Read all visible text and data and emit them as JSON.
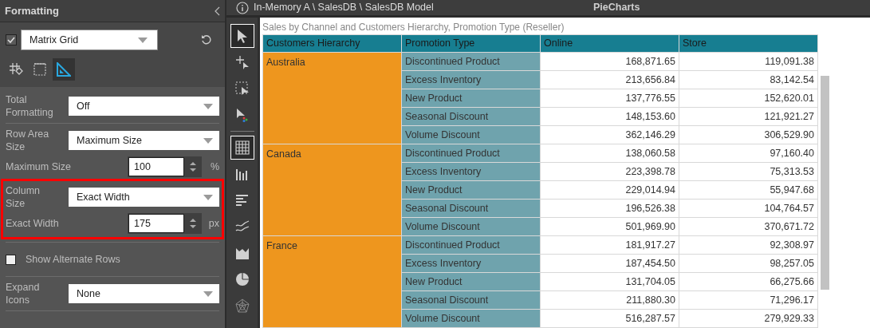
{
  "panel": {
    "title": "Formatting",
    "element": {
      "checked": true,
      "value": "Matrix Grid"
    },
    "tabs": [
      {
        "kind": "tag",
        "selected": false
      },
      {
        "kind": "border",
        "selected": false
      },
      {
        "kind": "ruler",
        "selected": true
      }
    ],
    "sections": [
      {
        "highlighted": false,
        "items": [
          {
            "kind": "select",
            "label": "Total Formatting",
            "value": "Off"
          }
        ]
      },
      {
        "highlighted": false,
        "items": [
          {
            "kind": "select",
            "label": "Row Area Size",
            "value": "Maximum Size"
          },
          {
            "kind": "number",
            "label": "Maximum Size",
            "value": "100",
            "unit": "%"
          }
        ]
      },
      {
        "highlighted": true,
        "items": [
          {
            "kind": "select",
            "label": "Column Size",
            "value": "Exact Width"
          },
          {
            "kind": "number",
            "label": "Exact Width",
            "value": "175",
            "unit": "px"
          }
        ]
      },
      {
        "highlighted": false,
        "items": [
          {
            "kind": "checkbox",
            "label": "Show Alternate Rows",
            "checked": false
          }
        ]
      },
      {
        "highlighted": false,
        "items": [
          {
            "kind": "select",
            "label": "Expand Icons",
            "value": "None"
          }
        ]
      }
    ]
  },
  "breadcrumb": "In-Memory A \\ SalesDB \\ SalesDB Model",
  "report_title": "PieCharts",
  "toolbar": {
    "tools": [
      {
        "kind": "pointer",
        "selected": true
      },
      {
        "kind": "add",
        "selected": false
      },
      {
        "kind": "lasso",
        "selected": false
      },
      {
        "kind": "paint",
        "selected": false
      }
    ],
    "visuals": [
      {
        "kind": "grid",
        "selected": true
      },
      {
        "kind": "columns",
        "selected": false
      },
      {
        "kind": "bars",
        "selected": false
      },
      {
        "kind": "lines",
        "selected": false
      },
      {
        "kind": "area",
        "selected": false
      },
      {
        "kind": "pie",
        "selected": false
      },
      {
        "kind": "radar",
        "selected": false
      }
    ]
  },
  "visual": {
    "title": "Sales by Channel and Customers Hierarchy, Promotion Type (Reseller)",
    "columns": [
      "Customers Hierarchy",
      "Promotion Type",
      "Online",
      "Store"
    ],
    "groups": [
      {
        "label": "Australia",
        "rows": [
          {
            "promotion": "Discontinued Product",
            "online": "168,871.65",
            "store": "119,091.38"
          },
          {
            "promotion": "Excess Inventory",
            "online": "213,656.84",
            "store": "83,142.54"
          },
          {
            "promotion": "New Product",
            "online": "137,776.55",
            "store": "152,620.01"
          },
          {
            "promotion": "Seasonal Discount",
            "online": "148,153.60",
            "store": "121,921.27"
          },
          {
            "promotion": "Volume Discount",
            "online": "362,146.29",
            "store": "306,529.90"
          }
        ]
      },
      {
        "label": "Canada",
        "rows": [
          {
            "promotion": "Discontinued Product",
            "online": "138,060.58",
            "store": "97,160.40"
          },
          {
            "promotion": "Excess Inventory",
            "online": "223,398.78",
            "store": "75,313.53"
          },
          {
            "promotion": "New Product",
            "online": "229,014.94",
            "store": "55,947.68"
          },
          {
            "promotion": "Seasonal Discount",
            "online": "196,526.38",
            "store": "104,764.57"
          },
          {
            "promotion": "Volume Discount",
            "online": "501,969.90",
            "store": "370,671.72"
          }
        ]
      },
      {
        "label": "France",
        "rows": [
          {
            "promotion": "Discontinued Product",
            "online": "181,917.27",
            "store": "92,308.97"
          },
          {
            "promotion": "Excess Inventory",
            "online": "187,454.50",
            "store": "98,257.05"
          },
          {
            "promotion": "New Product",
            "online": "131,704.05",
            "store": "66,275.66"
          },
          {
            "promotion": "Seasonal Discount",
            "online": "211,880.30",
            "store": "71,296.17"
          },
          {
            "promotion": "Volume Discount",
            "online": "516,287.57",
            "store": "279,929.33"
          }
        ]
      }
    ]
  }
}
